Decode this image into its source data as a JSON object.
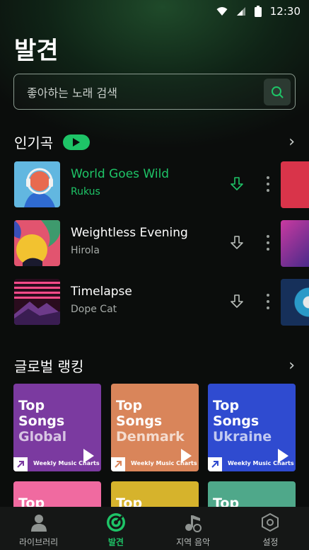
{
  "status": {
    "time": "12:30"
  },
  "header": {
    "title": "발견"
  },
  "search": {
    "placeholder": "좋아하는 노래 검색"
  },
  "popular": {
    "title": "인기곡",
    "tracks": [
      {
        "title": "World Goes Wild",
        "artist": "Rukus",
        "active": true
      },
      {
        "title": "Weightless Evening",
        "artist": "Hirola",
        "active": false
      },
      {
        "title": "Timelapse",
        "artist": "Dope Cat",
        "active": false
      }
    ]
  },
  "ranking": {
    "title": "글로벌 랭킹",
    "cards": [
      {
        "line1": "Top",
        "line2": "Songs",
        "line3": "Global",
        "footer": "Weekly Music Charts",
        "color": "#7b3aa0"
      },
      {
        "line1": "Top",
        "line2": "Songs",
        "line3": "Denmark",
        "footer": "Weekly Music Charts",
        "color": "#d9855a"
      },
      {
        "line1": "Top",
        "line2": "Songs",
        "line3": "Ukraine",
        "footer": "Weekly Music Charts",
        "color": "#2f4bd0"
      }
    ],
    "more_cards": [
      {
        "line1": "Top",
        "color": "#f06aa0"
      },
      {
        "line1": "Top",
        "color": "#d6b32c"
      },
      {
        "line1": "Top",
        "color": "#4fa88a"
      }
    ]
  },
  "nav": {
    "items": [
      {
        "label": "라이브러리",
        "icon": "person-icon"
      },
      {
        "label": "발견",
        "icon": "discover-icon"
      },
      {
        "label": "지역 음악",
        "icon": "music-note-icon"
      },
      {
        "label": "설정",
        "icon": "settings-hexagon-icon"
      }
    ],
    "active_index": 1
  },
  "colors": {
    "accent": "#1ec467",
    "background": "#0b0d0c"
  }
}
